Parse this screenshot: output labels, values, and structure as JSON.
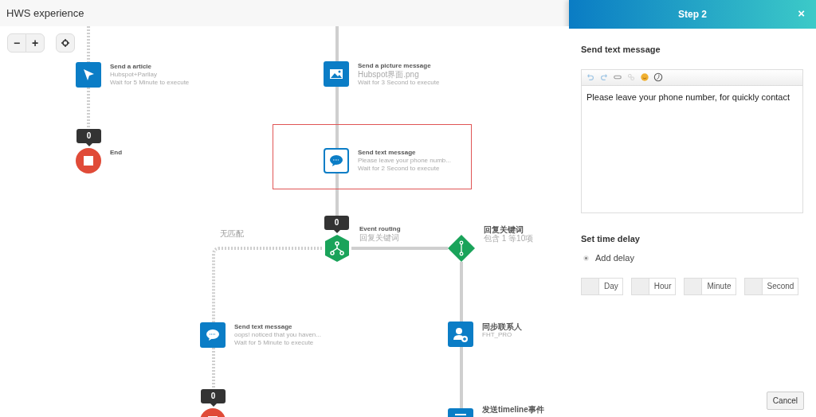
{
  "header": {
    "title": "HWS experience"
  },
  "zoom_controls": [
    {
      "label": "−"
    },
    {
      "label": "+"
    }
  ],
  "canvas": {
    "nodes": [
      {
        "kind": "article",
        "title": "Send a article",
        "lines": [
          "Hubspot+Parllay",
          "Wait for 5 Minute to execute"
        ],
        "selected": false
      },
      {
        "kind": "end",
        "title": "End",
        "count": "0",
        "selected": false
      },
      {
        "kind": "picture",
        "title": "Send a picture message",
        "lines": [
          "Hubspot界面.png",
          "Wait for 3 Second to execute"
        ],
        "selected": false
      },
      {
        "kind": "text",
        "title": "Send text message",
        "lines": [
          "Please leave your phone numb...",
          "Wait for 2 Second to execute"
        ],
        "selected": true
      },
      {
        "kind": "routing",
        "title": "Event routing",
        "lines": [
          "回复关键词"
        ],
        "count": "0",
        "selected": false
      },
      {
        "kind": "condition",
        "title": "回复关键词",
        "lines": [
          "包含 1 等10项"
        ],
        "selected": false
      },
      {
        "kind": "text",
        "title": "Send text message",
        "lines": [
          "oops! noticed that you haven...",
          "Wait for 5 Minute to execute"
        ],
        "selected": false
      },
      {
        "kind": "end",
        "count": "0",
        "selected": false
      },
      {
        "kind": "contact",
        "title": "同步联系人",
        "lines": [
          "FHT_PRO"
        ],
        "selected": false
      },
      {
        "kind": "timeline",
        "title": "发送timeline事件",
        "selected": false
      }
    ],
    "edge_labels": [
      "无匹配"
    ]
  },
  "panel": {
    "title": "Step 2",
    "close": "×",
    "section_title": "Send text message",
    "editor": {
      "value": "Please leave your phone number, for quickly contact"
    },
    "delay_title": "Set time delay",
    "delay_option": {
      "label": "Add delay",
      "checked": true
    },
    "delay_fields": [
      {
        "unit": "Day"
      },
      {
        "unit": "Hour"
      },
      {
        "unit": "Minute"
      },
      {
        "unit": "Second"
      }
    ],
    "cancel": "Cancel"
  }
}
